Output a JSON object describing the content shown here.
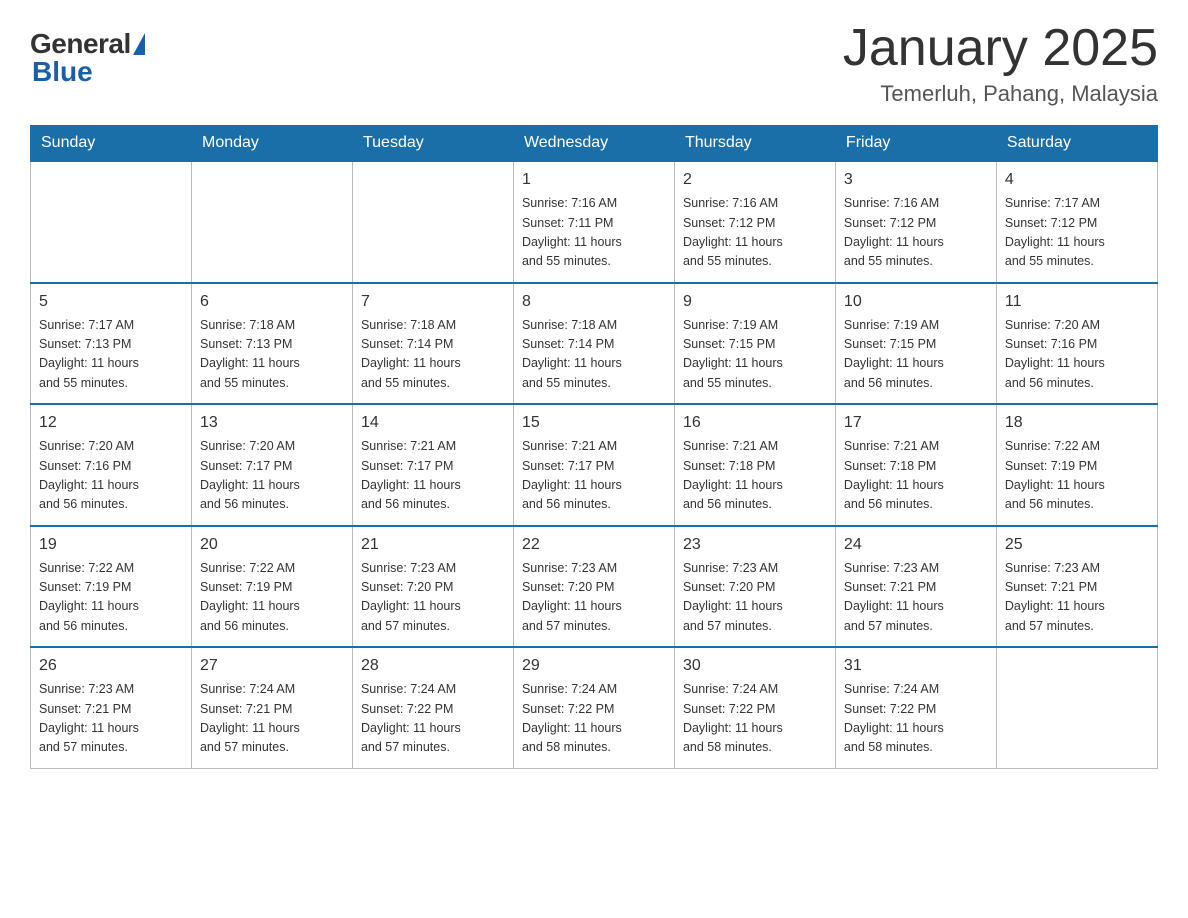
{
  "header": {
    "logo_general": "General",
    "logo_blue": "Blue",
    "month_title": "January 2025",
    "location": "Temerluh, Pahang, Malaysia"
  },
  "weekdays": [
    "Sunday",
    "Monday",
    "Tuesday",
    "Wednesday",
    "Thursday",
    "Friday",
    "Saturday"
  ],
  "weeks": [
    [
      {
        "day": "",
        "info": ""
      },
      {
        "day": "",
        "info": ""
      },
      {
        "day": "",
        "info": ""
      },
      {
        "day": "1",
        "info": "Sunrise: 7:16 AM\nSunset: 7:11 PM\nDaylight: 11 hours\nand 55 minutes."
      },
      {
        "day": "2",
        "info": "Sunrise: 7:16 AM\nSunset: 7:12 PM\nDaylight: 11 hours\nand 55 minutes."
      },
      {
        "day": "3",
        "info": "Sunrise: 7:16 AM\nSunset: 7:12 PM\nDaylight: 11 hours\nand 55 minutes."
      },
      {
        "day": "4",
        "info": "Sunrise: 7:17 AM\nSunset: 7:12 PM\nDaylight: 11 hours\nand 55 minutes."
      }
    ],
    [
      {
        "day": "5",
        "info": "Sunrise: 7:17 AM\nSunset: 7:13 PM\nDaylight: 11 hours\nand 55 minutes."
      },
      {
        "day": "6",
        "info": "Sunrise: 7:18 AM\nSunset: 7:13 PM\nDaylight: 11 hours\nand 55 minutes."
      },
      {
        "day": "7",
        "info": "Sunrise: 7:18 AM\nSunset: 7:14 PM\nDaylight: 11 hours\nand 55 minutes."
      },
      {
        "day": "8",
        "info": "Sunrise: 7:18 AM\nSunset: 7:14 PM\nDaylight: 11 hours\nand 55 minutes."
      },
      {
        "day": "9",
        "info": "Sunrise: 7:19 AM\nSunset: 7:15 PM\nDaylight: 11 hours\nand 55 minutes."
      },
      {
        "day": "10",
        "info": "Sunrise: 7:19 AM\nSunset: 7:15 PM\nDaylight: 11 hours\nand 56 minutes."
      },
      {
        "day": "11",
        "info": "Sunrise: 7:20 AM\nSunset: 7:16 PM\nDaylight: 11 hours\nand 56 minutes."
      }
    ],
    [
      {
        "day": "12",
        "info": "Sunrise: 7:20 AM\nSunset: 7:16 PM\nDaylight: 11 hours\nand 56 minutes."
      },
      {
        "day": "13",
        "info": "Sunrise: 7:20 AM\nSunset: 7:17 PM\nDaylight: 11 hours\nand 56 minutes."
      },
      {
        "day": "14",
        "info": "Sunrise: 7:21 AM\nSunset: 7:17 PM\nDaylight: 11 hours\nand 56 minutes."
      },
      {
        "day": "15",
        "info": "Sunrise: 7:21 AM\nSunset: 7:17 PM\nDaylight: 11 hours\nand 56 minutes."
      },
      {
        "day": "16",
        "info": "Sunrise: 7:21 AM\nSunset: 7:18 PM\nDaylight: 11 hours\nand 56 minutes."
      },
      {
        "day": "17",
        "info": "Sunrise: 7:21 AM\nSunset: 7:18 PM\nDaylight: 11 hours\nand 56 minutes."
      },
      {
        "day": "18",
        "info": "Sunrise: 7:22 AM\nSunset: 7:19 PM\nDaylight: 11 hours\nand 56 minutes."
      }
    ],
    [
      {
        "day": "19",
        "info": "Sunrise: 7:22 AM\nSunset: 7:19 PM\nDaylight: 11 hours\nand 56 minutes."
      },
      {
        "day": "20",
        "info": "Sunrise: 7:22 AM\nSunset: 7:19 PM\nDaylight: 11 hours\nand 56 minutes."
      },
      {
        "day": "21",
        "info": "Sunrise: 7:23 AM\nSunset: 7:20 PM\nDaylight: 11 hours\nand 57 minutes."
      },
      {
        "day": "22",
        "info": "Sunrise: 7:23 AM\nSunset: 7:20 PM\nDaylight: 11 hours\nand 57 minutes."
      },
      {
        "day": "23",
        "info": "Sunrise: 7:23 AM\nSunset: 7:20 PM\nDaylight: 11 hours\nand 57 minutes."
      },
      {
        "day": "24",
        "info": "Sunrise: 7:23 AM\nSunset: 7:21 PM\nDaylight: 11 hours\nand 57 minutes."
      },
      {
        "day": "25",
        "info": "Sunrise: 7:23 AM\nSunset: 7:21 PM\nDaylight: 11 hours\nand 57 minutes."
      }
    ],
    [
      {
        "day": "26",
        "info": "Sunrise: 7:23 AM\nSunset: 7:21 PM\nDaylight: 11 hours\nand 57 minutes."
      },
      {
        "day": "27",
        "info": "Sunrise: 7:24 AM\nSunset: 7:21 PM\nDaylight: 11 hours\nand 57 minutes."
      },
      {
        "day": "28",
        "info": "Sunrise: 7:24 AM\nSunset: 7:22 PM\nDaylight: 11 hours\nand 57 minutes."
      },
      {
        "day": "29",
        "info": "Sunrise: 7:24 AM\nSunset: 7:22 PM\nDaylight: 11 hours\nand 58 minutes."
      },
      {
        "day": "30",
        "info": "Sunrise: 7:24 AM\nSunset: 7:22 PM\nDaylight: 11 hours\nand 58 minutes."
      },
      {
        "day": "31",
        "info": "Sunrise: 7:24 AM\nSunset: 7:22 PM\nDaylight: 11 hours\nand 58 minutes."
      },
      {
        "day": "",
        "info": ""
      }
    ]
  ]
}
